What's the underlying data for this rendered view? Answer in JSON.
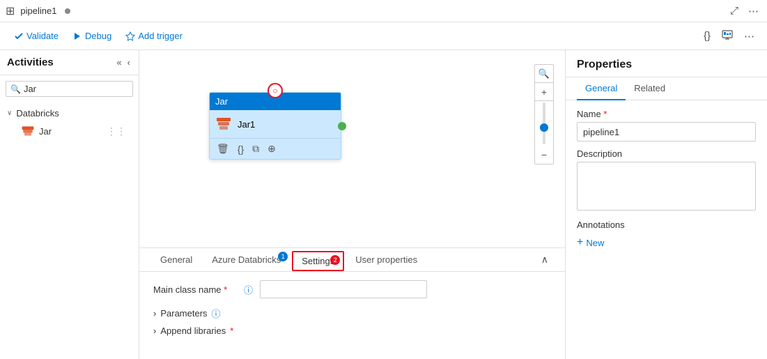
{
  "topbar": {
    "icon": "⊞",
    "title": "pipeline1",
    "dot_label": "•",
    "expand_label": "⤢",
    "more_label": "⋯"
  },
  "toolbar": {
    "validate_label": "Validate",
    "debug_label": "Debug",
    "add_trigger_label": "Add trigger",
    "code_label": "{}",
    "monitor_label": "📊",
    "more_label": "⋯"
  },
  "left_panel": {
    "title": "Activities",
    "collapse_label": "«",
    "expand_label": "‹",
    "search_placeholder": "Jar",
    "search_value": "Jar",
    "category": {
      "label": "Databricks",
      "items": [
        {
          "label": "Jar"
        }
      ]
    }
  },
  "canvas": {
    "node": {
      "header": "Jar",
      "label": "Jar1",
      "connector_top": "⊙",
      "delete_icon": "🗑",
      "code_icon": "{}",
      "copy_icon": "⧉",
      "arrow_icon": "⊕"
    }
  },
  "bottom_panel": {
    "tabs": [
      {
        "label": "General",
        "badge": null,
        "active": false
      },
      {
        "label": "Azure Databricks",
        "badge": "1",
        "active": false
      },
      {
        "label": "Settings",
        "badge": "2",
        "active": true
      },
      {
        "label": "User properties",
        "badge": null,
        "active": false
      }
    ],
    "collapse_btn": "∧",
    "main_class_label": "Main class name",
    "main_class_placeholder": "",
    "parameters_label": "Parameters",
    "append_libraries_label": "Append libraries"
  },
  "right_panel": {
    "title": "Properties",
    "tabs": [
      {
        "label": "General",
        "active": true
      },
      {
        "label": "Related",
        "active": false
      }
    ],
    "name_label": "Name",
    "name_value": "pipeline1",
    "description_label": "Description",
    "description_value": "",
    "annotations_label": "Annotations",
    "add_new_label": "New"
  }
}
